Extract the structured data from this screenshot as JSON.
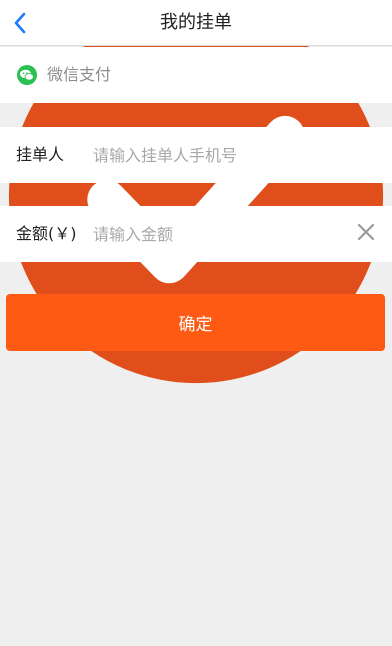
{
  "header": {
    "title": "我的挂单",
    "back_icon": "chevron-left-icon"
  },
  "payment": {
    "icon": "wechat-icon",
    "label": "微信支付",
    "selected": true,
    "check_icon": "check-circle-icon"
  },
  "form": {
    "payer": {
      "label": "挂单人",
      "value": "",
      "placeholder": "请输入挂单人手机号"
    },
    "amount": {
      "label": "金额(￥)",
      "value": "",
      "placeholder": "请输入金额",
      "clear_icon": "close-icon"
    }
  },
  "confirm_button": {
    "label": "确定"
  },
  "colors": {
    "accent": "#fe5a13",
    "back_arrow": "#1f7aff",
    "wechat_green": "#2ac052",
    "check": "#e04e1b",
    "background": "#efefef"
  }
}
